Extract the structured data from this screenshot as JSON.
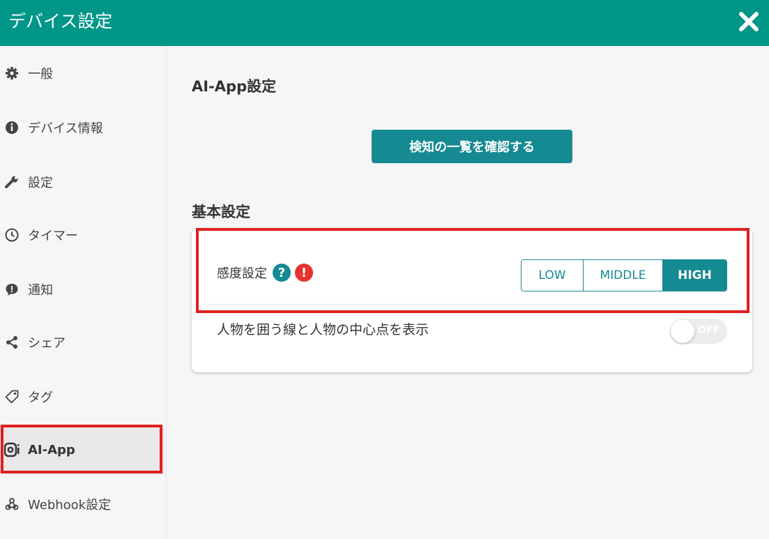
{
  "header": {
    "title": "デバイス設定"
  },
  "sidebar": {
    "items": [
      {
        "label": "一般",
        "icon": "gear-icon"
      },
      {
        "label": "デバイス情報",
        "icon": "info-icon"
      },
      {
        "label": "設定",
        "icon": "wrench-icon"
      },
      {
        "label": "タイマー",
        "icon": "clock-icon"
      },
      {
        "label": "通知",
        "icon": "notification-icon"
      },
      {
        "label": "シェア",
        "icon": "share-icon"
      },
      {
        "label": "タグ",
        "icon": "tag-icon"
      },
      {
        "label": "AI-App",
        "icon": "ai-app-icon",
        "active": true
      },
      {
        "label": "Webhook設定",
        "icon": "webhook-icon"
      }
    ]
  },
  "main": {
    "section_title": "AI-App設定",
    "detection_button": "検知の一覧を確認する",
    "basic_title": "基本設定",
    "sensitivity": {
      "label": "感度設定",
      "options": [
        "LOW",
        "MIDDLE",
        "HIGH"
      ],
      "selected": "HIGH"
    },
    "bounding_box": {
      "label": "人物を囲う線と人物の中心点を表示",
      "state": "OFF"
    }
  },
  "colors": {
    "header": "#009688",
    "accent": "#158a93",
    "highlight": "#e01f1f",
    "warning": "#e8322f"
  }
}
